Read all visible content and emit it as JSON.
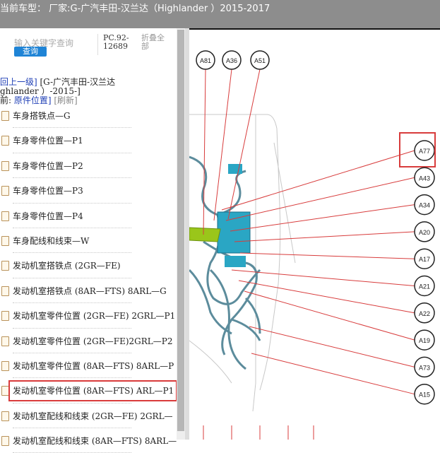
{
  "topbar": {
    "text": "当前车型：  厂家:G-广汽丰田-汉兰达（Highlander ）2015-2017"
  },
  "search": {
    "placeholder": "输入关键字查询",
    "button": "查询"
  },
  "pc_code": {
    "line1": "PC.92-",
    "line2": "12689"
  },
  "collapse": {
    "line1": "折叠全",
    "line2": "部"
  },
  "nav": {
    "back_link": "回上一级]",
    "path_text": " [G-广汽丰田-汉兰达",
    "line2": "ghlander ）-2015-]",
    "line3_prefix": "前: ",
    "current": "原件位置]",
    "refresh": " [刷新]"
  },
  "list_items": [
    {
      "label": "车身搭铁点—G"
    },
    {
      "label": "车身零件位置—P1"
    },
    {
      "label": "车身零件位置—P2"
    },
    {
      "label": "车身零件位置—P3"
    },
    {
      "label": "车身零件位置—P4"
    },
    {
      "label": "车身配线和线束—W"
    },
    {
      "label": "发动机室搭铁点 (2GR—FE)"
    },
    {
      "label": "发动机室搭铁点 (8AR—FTS) 8ARL—G"
    },
    {
      "label": "发动机室零件位置 (2GR—FE) 2GRL—P1"
    },
    {
      "label": "发动机室零件位置 (2GR—FE)2GRL—P2"
    },
    {
      "label": "发动机室零件位置 (8AR—FTS) 8ARL—P"
    },
    {
      "label": "发动机室零件位置 (8AR—FTS) ARL—P1",
      "highlighted": true
    },
    {
      "label": "发动机室配线和线束 (2GR—FE) 2GRL—"
    },
    {
      "label": "发动机室配线和线束 (8AR—FTS) 8ARL—"
    }
  ],
  "diagram": {
    "top_labels": [
      "A81",
      "A36",
      "A51"
    ],
    "right_labels": [
      "A77",
      "A43",
      "A34",
      "A20",
      "A17",
      "A21",
      "A22",
      "A19",
      "A73",
      "A15"
    ],
    "highlighted_label": "A77",
    "line_color": "#d83c3c",
    "wire_color": "#5c8c9c",
    "part_color": "#2aa6c4",
    "accent_green": "#9ac61a"
  },
  "colors": {
    "topbar_bg": "#8d8d8d",
    "button_bg": "#1f84d6",
    "highlight_border": "#d93b3b",
    "link": "#1f3fb6"
  }
}
